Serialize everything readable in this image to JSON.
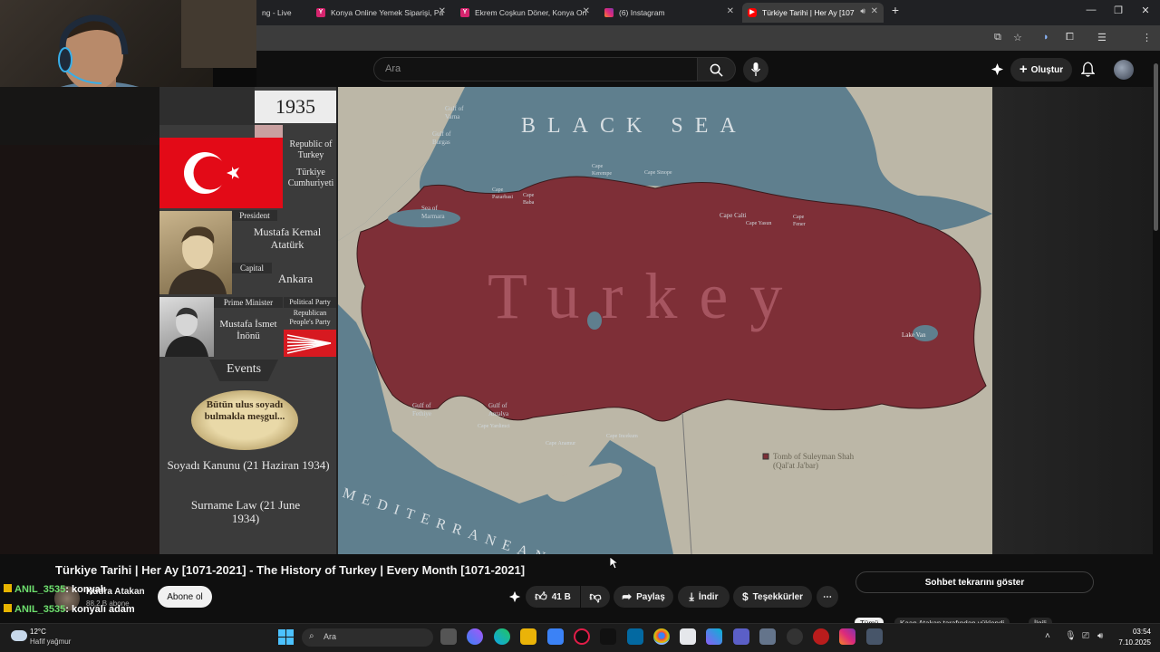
{
  "browser": {
    "tabs": [
      {
        "title": "ng - Live",
        "active": false
      },
      {
        "title": "Konya Online Yemek Siparişi, Pa",
        "active": false
      },
      {
        "title": "Ekrem Coşkun Döner, Konya On",
        "active": false
      },
      {
        "title": "(6) Instagram",
        "active": false
      },
      {
        "title": "Türkiye Tarihi | Her Ay [107",
        "active": true
      }
    ],
    "new_tab": "+"
  },
  "youtube": {
    "search_placeholder": "Ara",
    "create_label": "Oluştur"
  },
  "video_overlay": {
    "year": "1935",
    "country_en": "Republic of Turkey",
    "country_tr": "Türkiye Cumhuriyeti",
    "president_label": "President",
    "president_name": "Mustafa Kemal Atatürk",
    "capital_label": "Capital",
    "capital_name": "Ankara",
    "pm_label": "Prime Minister",
    "pm_name": "Mustafa İsmet İnönü",
    "party_label": "Political Party",
    "party_name": "Republican People's Party",
    "events_label": "Events",
    "event_tr": "Soyadı Kanunu (21 Haziran 1934)",
    "event_en": "Surname Law (21 June 1934)",
    "newspaper_text": "Bütün ulus soyadı bulmakla meşgul..."
  },
  "map": {
    "black_sea": "BLACK SEA",
    "country": "Turkey",
    "mediterranean": "MEDITERRANEAN SEA",
    "gulf_varna": "Gulf of Varna",
    "gulf_burgas": "Gulf of Burgas",
    "sea_marmara": "Sea of Marmara",
    "cape_kerempe": "Cape Kerempe",
    "cape_sinope": "Cape Sinope",
    "cape_pazarbasi": "Cape Pazarbasi",
    "cape_baba": "Cape Baba",
    "cape_calti": "Cape Calti",
    "cape_yasun": "Cape Yasun",
    "cape_fener": "Cape Fener",
    "lake_van": "Lake Van",
    "gulf_fethiye": "Gulf of Fethiye",
    "gulf_antalya": "Gulf of Antalya",
    "cape_yardimci": "Cape Yardimci",
    "cape_anamur": "Cape Anamur",
    "cape_incekum": "Cape Incekum",
    "tomb": "Tomb of Suleyman Shah",
    "tomb_sub": "(Qal'at Ja'bar)"
  },
  "video_info": {
    "title": "Türkiye Tarihi | Her Ay [1071-2021] - The History of Turkey | Every Month [1071-2021]",
    "channel": "Kudra Atakan",
    "subscribers": "88,2 B abone",
    "subscribe": "Abone ol",
    "likes": "41 B",
    "share": "Paylaş",
    "download": "İndir",
    "thanks": "Teşekkürler",
    "chat_replay": "Sohbet tekrarını göster",
    "chips": [
      "Tümü",
      "Kaan Atakan tarafından yüklendi",
      "İlgili"
    ]
  },
  "stream_chat": [
    {
      "user": "ANIL_3535",
      "message": ": konyalı"
    },
    {
      "user": "ANIL_3535",
      "message": ": konyalı adam"
    }
  ],
  "taskbar": {
    "temperature": "12°C",
    "weather": "Hafif yağmur",
    "search": "Ara",
    "time": "03:54",
    "date": "7.10.2025"
  }
}
